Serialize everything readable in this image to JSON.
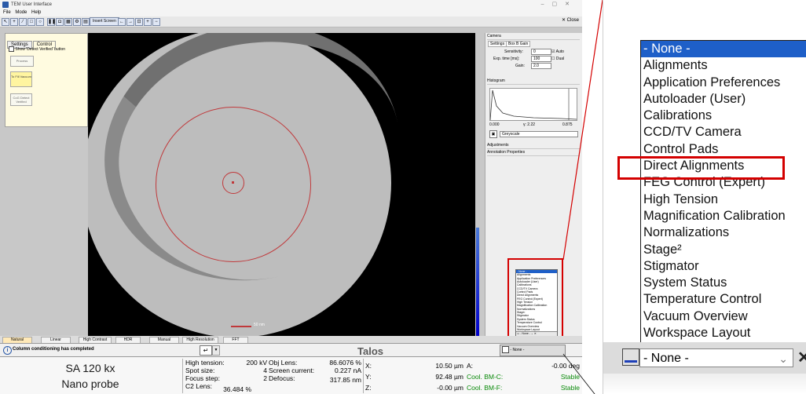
{
  "window": {
    "title": "TEM User Interface"
  },
  "menu": [
    "File",
    "Mode",
    "Help"
  ],
  "toolbar": {
    "insert_screen_label": "Insert Screen",
    "close_label": "✕ Close"
  },
  "left_panel": {
    "tabs": [
      "Settings",
      "Control"
    ],
    "checkbox_label": "Show 'Detect Verified' button",
    "buttons": [
      "Process",
      "To Fill Vacuum",
      "CoG Detect Verified"
    ]
  },
  "viewer": {
    "scale_label": "50 nm"
  },
  "right_panel": {
    "camera_header": "Camera",
    "tabs": [
      "Settings",
      "Box B Gain"
    ],
    "sensitivity_label": "Sensitivity:",
    "sensitivity_value": "0",
    "auto_label": "Auto",
    "exp_time_label": "Exp. time [ms]:",
    "exp_time_value": "100",
    "dual_label": "Dual",
    "gain_label": "Gain:",
    "gain_value": "2.0",
    "histogram_header": "Histogram",
    "histo_min": "0.000",
    "histo_gamma": "γ: 2.22",
    "histo_max": "0.875",
    "colormap_value": "Greyscale",
    "adjustments_header": "Adjustments",
    "annotation_header": "Annotation Properties"
  },
  "filters": [
    "Natural",
    "Linear",
    "High Contrast",
    "HDR",
    "Manual",
    "High Resolution",
    "FFT"
  ],
  "status": {
    "message": "Column conditioning has completed",
    "brand": "Talos"
  },
  "footer": {
    "mag": "SA 120 kx",
    "probe": "Nano probe",
    "high_tension_label": "High tension:",
    "high_tension_value": "200 kV",
    "spot_size_label": "Spot size:",
    "spot_size_value": "4",
    "focus_step_label": "Focus step:",
    "focus_step_value": "2",
    "c2_lens_label": "C2 Lens:",
    "c2_lens_value": "36.484 %",
    "obj_lens_label": "Obj Lens:",
    "obj_lens_value": "86.6076 %",
    "screen_current_label": "Screen current:",
    "screen_current_value": "0.227 nA",
    "defocus_label": "Defocus:",
    "defocus_value": "317.85 nm",
    "x_label": "X:",
    "x_value": "10.50 µm",
    "y_label": "Y:",
    "y_value": "92.48 µm",
    "z_label": "Z:",
    "z_value": "-0.00 µm",
    "a_label": "A:",
    "a_value": "-0.00 deg",
    "cool_c_label": "Cool. BM-C:",
    "cool_c_value": "Stable",
    "cool_f_label": "Cool. BM-F:",
    "cool_f_value": "Stable"
  },
  "dropdown": {
    "items": [
      "- None -",
      "Alignments",
      "Application Preferences",
      "Autoloader (User)",
      "Calibrations",
      "CCD/TV Camera",
      "Control Pads",
      "Direct Alignments",
      "FEG Control (Expert)",
      "High Tension",
      "Magnification Calibration",
      "Normalizations",
      "Stage²",
      "Stigmator",
      "System Status",
      "Temperature Control",
      "Vacuum Overview",
      "Workspace Layout"
    ],
    "selected": "- None -",
    "close_glyph": "✕"
  },
  "colors": {
    "accent_red": "#d40000",
    "selection_blue": "#1e5fc8",
    "status_green": "#0a8a0a"
  }
}
